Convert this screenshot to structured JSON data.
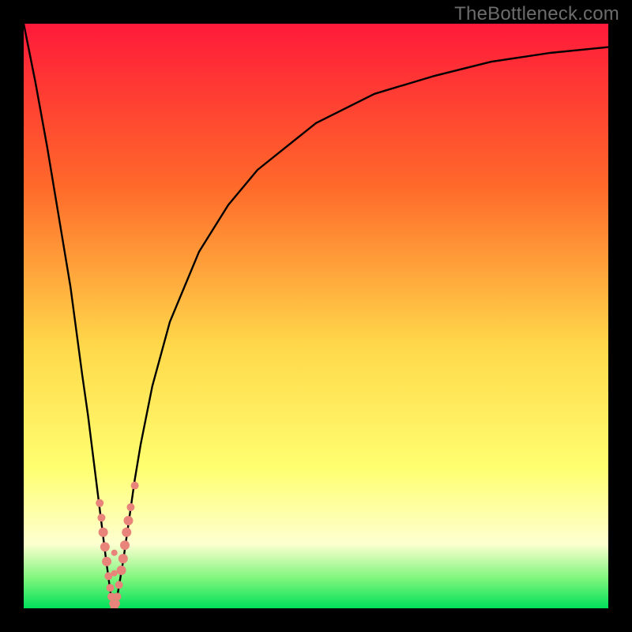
{
  "watermark": "TheBottleneck.com",
  "colors": {
    "frame": "#000000",
    "gradient_top": "#ff1a3a",
    "gradient_mid_upper": "#ff6a2a",
    "gradient_mid": "#ffd84a",
    "gradient_mid_lower": "#ffff70",
    "gradient_pale": "#fdffd0",
    "gradient_green_mid": "#7cf57c",
    "gradient_green": "#00e05a",
    "curve": "#000000",
    "marker_fill": "#e8847a",
    "marker_stroke": "#b25850"
  },
  "chart_data": {
    "type": "line",
    "title": "",
    "xlabel": "",
    "ylabel": "",
    "x_range": [
      0,
      100
    ],
    "y_range": [
      0,
      100
    ],
    "notch_x": 15.5,
    "series": [
      {
        "name": "left-branch",
        "x": [
          0,
          2,
          4,
          6,
          8,
          10,
          11,
          12,
          13,
          14,
          14.8,
          15.2,
          15.5
        ],
        "y": [
          100,
          90,
          79,
          67,
          55,
          40,
          33,
          25,
          17,
          9,
          3,
          1,
          0
        ]
      },
      {
        "name": "right-branch",
        "x": [
          15.5,
          16,
          17,
          18,
          19,
          20,
          22,
          25,
          30,
          35,
          40,
          50,
          60,
          70,
          80,
          90,
          100
        ],
        "y": [
          0,
          2,
          8,
          15,
          22,
          28,
          38,
          49,
          61,
          69,
          75,
          83,
          88,
          91,
          93.5,
          95,
          96
        ]
      }
    ],
    "markers": [
      {
        "x": 13.0,
        "y": 18.0,
        "r": 5
      },
      {
        "x": 13.3,
        "y": 15.5,
        "r": 5
      },
      {
        "x": 13.6,
        "y": 13.0,
        "r": 6
      },
      {
        "x": 13.9,
        "y": 10.5,
        "r": 6
      },
      {
        "x": 14.2,
        "y": 8.0,
        "r": 6
      },
      {
        "x": 14.5,
        "y": 5.5,
        "r": 5
      },
      {
        "x": 14.8,
        "y": 3.5,
        "r": 5
      },
      {
        "x": 15.0,
        "y": 2.0,
        "r": 5
      },
      {
        "x": 15.3,
        "y": 0.8,
        "r": 5
      },
      {
        "x": 15.5,
        "y": 0.2,
        "r": 5
      },
      {
        "x": 15.8,
        "y": 0.8,
        "r": 5
      },
      {
        "x": 16.0,
        "y": 2.0,
        "r": 5
      },
      {
        "x": 16.3,
        "y": 4.0,
        "r": 5
      },
      {
        "x": 15.5,
        "y": 6.0,
        "r": 4
      },
      {
        "x": 16.7,
        "y": 6.5,
        "r": 6
      },
      {
        "x": 17.0,
        "y": 8.5,
        "r": 6
      },
      {
        "x": 15.5,
        "y": 9.5,
        "r": 4
      },
      {
        "x": 17.3,
        "y": 10.8,
        "r": 6
      },
      {
        "x": 17.6,
        "y": 13.0,
        "r": 6
      },
      {
        "x": 17.9,
        "y": 15.0,
        "r": 6
      },
      {
        "x": 18.3,
        "y": 17.3,
        "r": 5
      },
      {
        "x": 19.0,
        "y": 21.0,
        "r": 5
      }
    ]
  }
}
